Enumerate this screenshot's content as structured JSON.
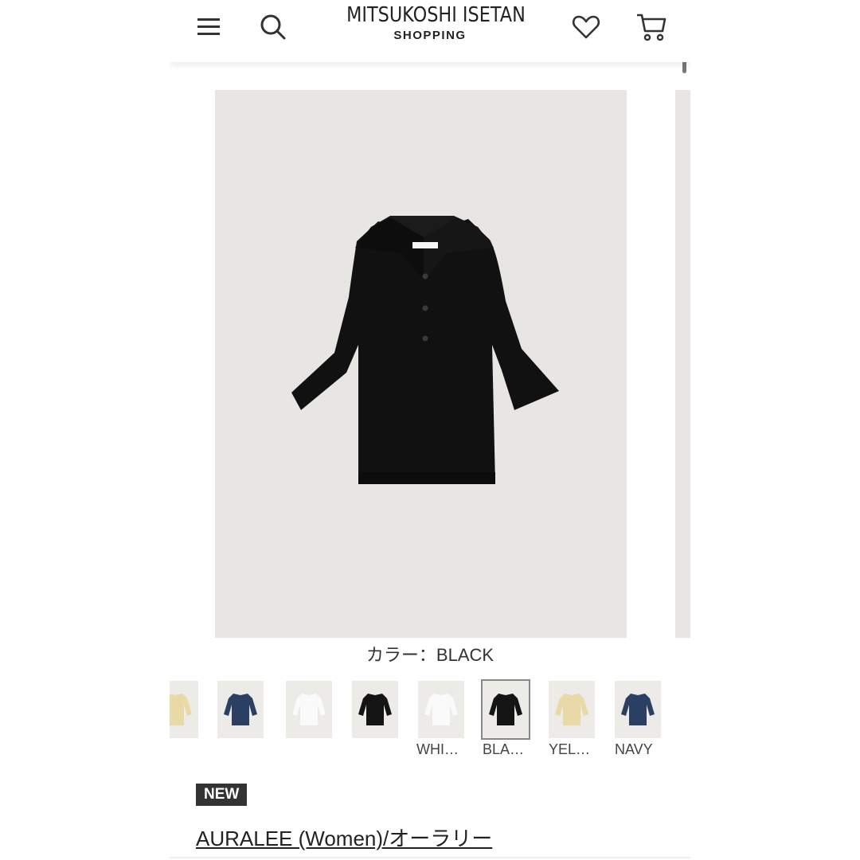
{
  "header": {
    "logo_main": "MITSUKOSHI ISETAN",
    "logo_sub": "SHOPPING",
    "icons": {
      "menu": "menu-icon",
      "search": "search-icon",
      "favorite": "heart-icon",
      "cart": "cart-icon"
    }
  },
  "product": {
    "color_caption": "カラー：BLACK",
    "badge": "NEW",
    "brand": "AURALEE (Women)/オーラリー",
    "main_image_color": "#e8e6e3",
    "garment_color": "#111111"
  },
  "thumbnails": [
    {
      "color": "#e9d9a6",
      "label": ""
    },
    {
      "color": "#2b3f62",
      "label": ""
    },
    {
      "color": "#f4f4f2",
      "label": ""
    },
    {
      "color": "#141414",
      "label": ""
    },
    {
      "color": "#f4f4f2",
      "label": "WHI…"
    },
    {
      "color": "#141414",
      "label": "BLA…",
      "selected": true
    },
    {
      "color": "#e9d9a6",
      "label": "YEL…"
    },
    {
      "color": "#2b3f62",
      "label": "NAVY"
    }
  ]
}
